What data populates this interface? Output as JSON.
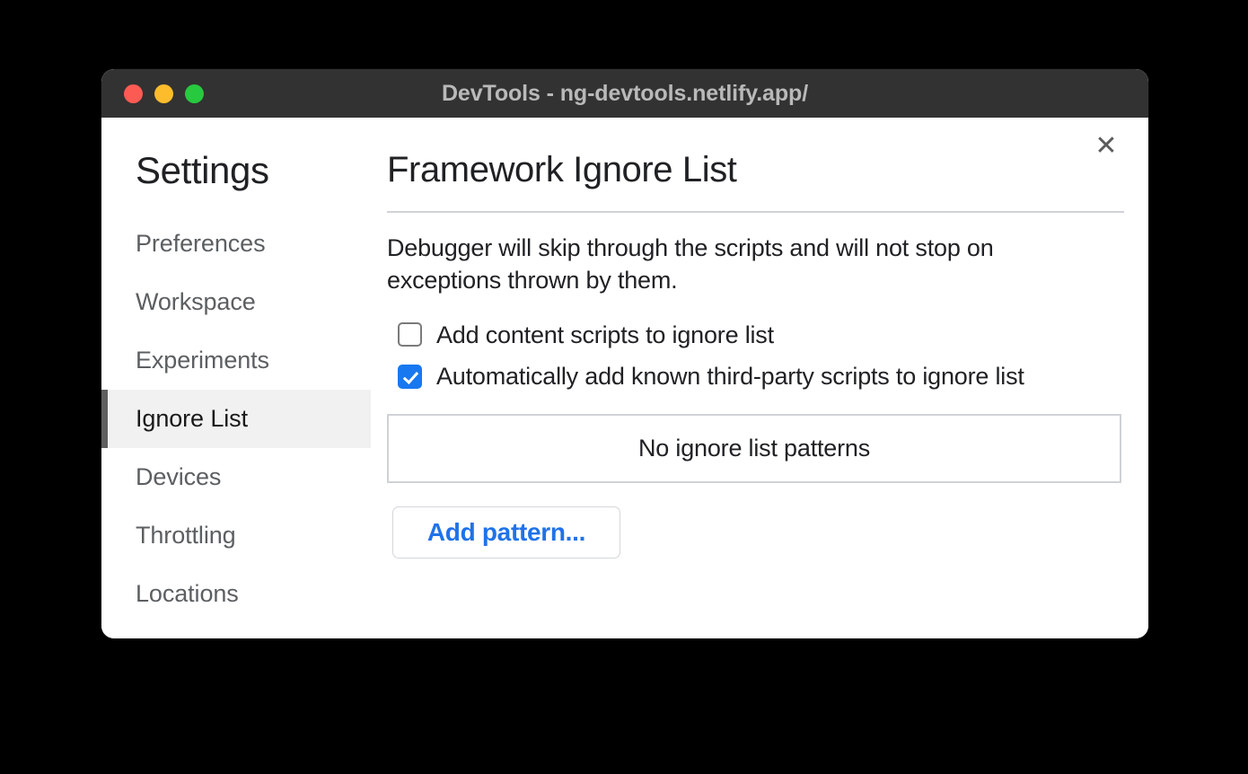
{
  "window": {
    "title": "DevTools - ng-devtools.netlify.app/",
    "traffic_lights": {
      "close_color": "#fc5b54",
      "minimize_color": "#fdbc2c",
      "maximize_color": "#27c93f"
    }
  },
  "settings_dialog": {
    "close_glyph": "✕",
    "sidebar": {
      "heading": "Settings",
      "items": [
        {
          "label": "Preferences",
          "selected": false
        },
        {
          "label": "Workspace",
          "selected": false
        },
        {
          "label": "Experiments",
          "selected": false
        },
        {
          "label": "Ignore List",
          "selected": true
        },
        {
          "label": "Devices",
          "selected": false
        },
        {
          "label": "Throttling",
          "selected": false
        },
        {
          "label": "Locations",
          "selected": false
        }
      ],
      "selected_item": "Ignore List"
    },
    "panel": {
      "title": "Framework Ignore List",
      "description": "Debugger will skip through the scripts and will not stop on exceptions thrown by them.",
      "checkboxes": [
        {
          "label": "Add content scripts to ignore list",
          "checked": false
        },
        {
          "label": "Automatically add known third-party scripts to ignore list",
          "checked": true
        }
      ],
      "patterns_empty_text": "No ignore list patterns",
      "add_pattern_label": "Add pattern..."
    }
  },
  "colors": {
    "accent_blue": "#1878f0",
    "link_blue": "#1f73e8",
    "titlebar_bg": "#323232",
    "selected_nav_bg": "#f1f1f1",
    "selected_nav_marker": "#5f5f5f",
    "border_gray": "#cfd2d6"
  }
}
